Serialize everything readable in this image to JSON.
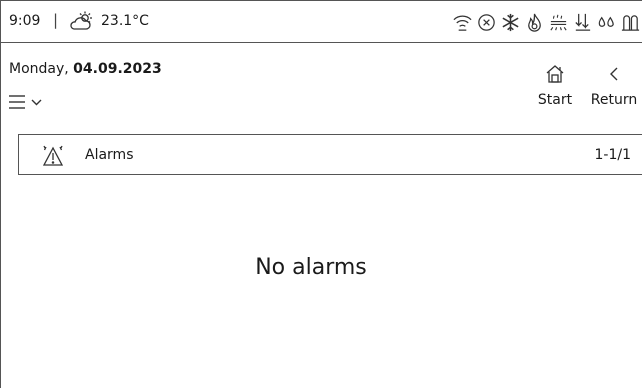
{
  "statusbar": {
    "time": "9:09",
    "separator": "|",
    "weather_icon": "partly-sunny-icon",
    "temperature": "23.1°C",
    "icons": [
      "wifi-icon",
      "error-circle-icon",
      "snowflake-icon",
      "flame-icon",
      "heating-icon",
      "ventilation-icon",
      "water-drops-icon",
      "valve-icon"
    ]
  },
  "header": {
    "date_prefix": "Monday,",
    "date_value": "04.09.2023",
    "menu_icon": "hamburger-menu-icon",
    "start_label": "Start",
    "return_label": "Return"
  },
  "alarms": {
    "icon": "alarm-warning-icon",
    "title": "Alarms",
    "count": "1-1/1",
    "empty_message": "No alarms"
  }
}
